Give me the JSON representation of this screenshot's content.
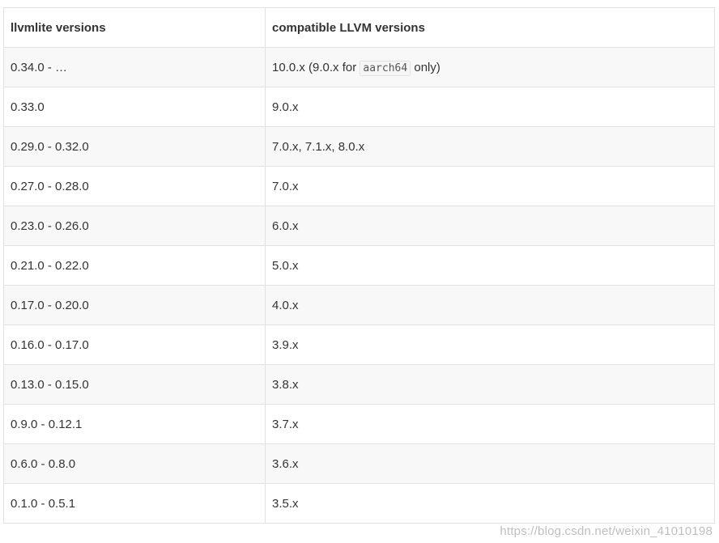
{
  "table": {
    "headers": [
      "llvmlite versions",
      "compatible LLVM versions"
    ],
    "rows": [
      {
        "llvmlite": "0.34.0 - …",
        "llvm_pre": "10.0.x (9.0.x for ",
        "llvm_code": "aarch64",
        "llvm_post": " only)"
      },
      {
        "llvmlite": "0.33.0",
        "llvm": "9.0.x"
      },
      {
        "llvmlite": "0.29.0 - 0.32.0",
        "llvm": "7.0.x, 7.1.x, 8.0.x"
      },
      {
        "llvmlite": "0.27.0 - 0.28.0",
        "llvm": "7.0.x"
      },
      {
        "llvmlite": "0.23.0 - 0.26.0",
        "llvm": "6.0.x"
      },
      {
        "llvmlite": "0.21.0 - 0.22.0",
        "llvm": "5.0.x"
      },
      {
        "llvmlite": "0.17.0 - 0.20.0",
        "llvm": "4.0.x"
      },
      {
        "llvmlite": "0.16.0 - 0.17.0",
        "llvm": "3.9.x"
      },
      {
        "llvmlite": "0.13.0 - 0.15.0",
        "llvm": "3.8.x"
      },
      {
        "llvmlite": "0.9.0 - 0.12.1",
        "llvm": "3.7.x"
      },
      {
        "llvmlite": "0.6.0 - 0.8.0",
        "llvm": "3.6.x"
      },
      {
        "llvmlite": "0.1.0 - 0.5.1",
        "llvm": "3.5.x"
      }
    ]
  },
  "watermark": "https://blog.csdn.net/weixin_41010198"
}
